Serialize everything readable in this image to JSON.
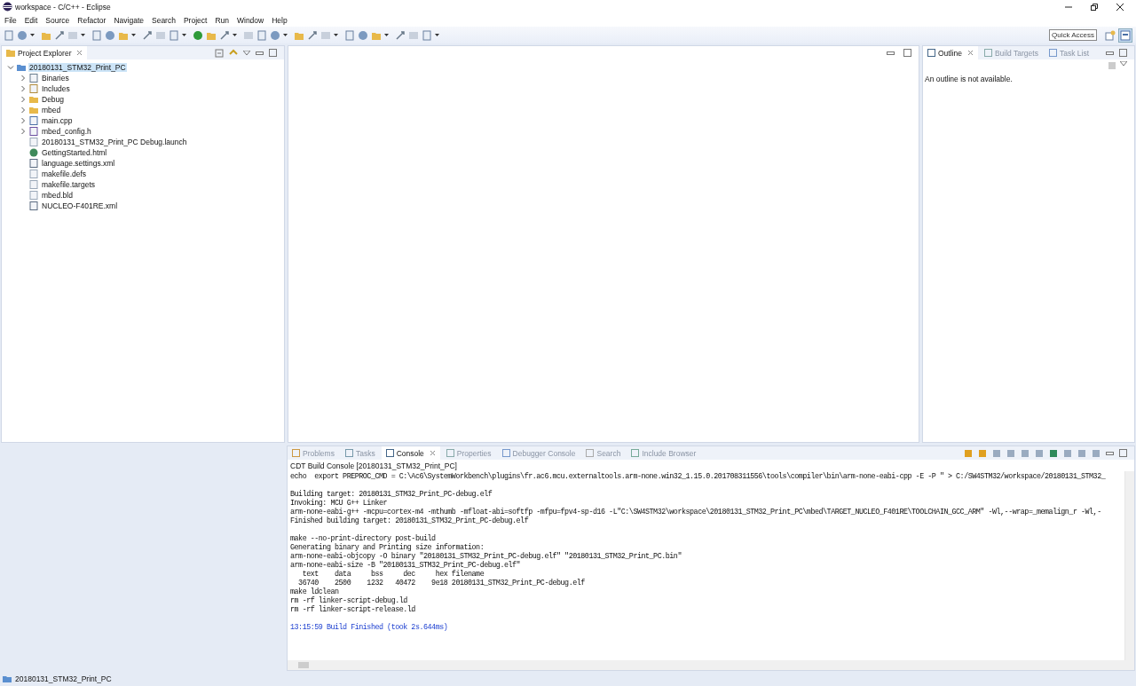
{
  "window": {
    "title": "workspace - C/C++ - Eclipse"
  },
  "menu": [
    "File",
    "Edit",
    "Source",
    "Refactor",
    "Navigate",
    "Search",
    "Project",
    "Run",
    "Window",
    "Help"
  ],
  "quick_access": {
    "placeholder": "Quick Access"
  },
  "project_explorer": {
    "tabs": [
      {
        "label": "Project Explorer",
        "selected": true
      }
    ],
    "tree": [
      {
        "label": "20180131_STM32_Print_PC",
        "kind": "project",
        "expanded": true,
        "selected": true,
        "children": [
          {
            "label": "Binaries",
            "kind": "binaries",
            "expanded": false,
            "selected": false
          },
          {
            "label": "Includes",
            "kind": "includes",
            "expanded": false,
            "selected": false
          },
          {
            "label": "Debug",
            "kind": "folder",
            "expanded": false,
            "selected": false
          },
          {
            "label": "mbed",
            "kind": "folder",
            "expanded": false,
            "selected": false
          },
          {
            "label": "main.cpp",
            "kind": "source",
            "expanded": false,
            "selected": false
          },
          {
            "label": "mbed_config.h",
            "kind": "header",
            "expanded": false,
            "selected": false
          },
          {
            "label": "20180131_STM32_Print_PC Debug.launch",
            "kind": "file",
            "selected": false
          },
          {
            "label": "GettingStarted.html",
            "kind": "globe",
            "selected": false
          },
          {
            "label": "language.settings.xml",
            "kind": "xml",
            "selected": false
          },
          {
            "label": "makefile.defs",
            "kind": "file",
            "selected": false
          },
          {
            "label": "makefile.targets",
            "kind": "file",
            "selected": false
          },
          {
            "label": "mbed.bld",
            "kind": "file",
            "selected": false
          },
          {
            "label": "NUCLEO-F401RE.xml",
            "kind": "xml",
            "selected": false
          }
        ]
      }
    ]
  },
  "outline_panel": {
    "tabs": [
      {
        "label": "Outline",
        "selected": true
      },
      {
        "label": "Build Targets",
        "selected": false
      },
      {
        "label": "Task List",
        "selected": false
      }
    ],
    "message": "An outline is not available."
  },
  "bottom_panel": {
    "tabs": [
      {
        "label": "Problems",
        "selected": false
      },
      {
        "label": "Tasks",
        "selected": false
      },
      {
        "label": "Console",
        "selected": true
      },
      {
        "label": "Properties",
        "selected": false
      },
      {
        "label": "Debugger Console",
        "selected": false
      },
      {
        "label": "Search",
        "selected": false
      },
      {
        "label": "Include Browser",
        "selected": false
      }
    ],
    "console_title": "CDT Build Console [20180131_STM32_Print_PC]",
    "blocks": [
      {
        "kind": "output",
        "lines": [
          "echo  export PREPROC_CMD = C:\\Ac6\\SystemWorkbench\\plugins\\fr.ac6.mcu.externaltools.arm-none.win32_1.15.0.201708311556\\tools\\compiler\\bin\\arm-none-eabi-cpp -E -P \" > C:/SW4STM32/workspace/20180131_STM32_"
        ]
      },
      {
        "kind": "output",
        "lines": [
          "Building target: 20180131_STM32_Print_PC-debug.elf",
          "Invoking: MCU G++ Linker",
          "arm-none-eabi-g++ -mcpu=cortex-m4 -mthumb -mfloat-abi=softfp -mfpu=fpv4-sp-d16 -L\"C:\\SW4STM32\\workspace\\20180131_STM32_Print_PC\\mbed\\TARGET_NUCLEO_F401RE\\TOOLCHAIN_GCC_ARM\" -Wl,--wrap=_memalign_r -Wl,-",
          "Finished building target: 20180131_STM32_Print_PC-debug.elf"
        ]
      },
      {
        "kind": "output",
        "lines": [
          "make --no-print-directory post-build",
          "Generating binary and Printing size information:",
          "arm-none-eabi-objcopy -O binary \"20180131_STM32_Print_PC-debug.elf\" \"20180131_STM32_Print_PC.bin\"",
          "arm-none-eabi-size -B \"20180131_STM32_Print_PC-debug.elf\"",
          "   text    data     bss     dec     hex filename",
          "  36740    2500    1232   40472    9e18 20180131_STM32_Print_PC-debug.elf",
          "make ldclean",
          "rm -rf linker-script-debug.ld",
          "rm -rf linker-script-release.ld"
        ]
      },
      {
        "kind": "status",
        "lines": [
          "13:15:59 Build Finished (took 2s.644ms)"
        ]
      }
    ]
  },
  "status_bar": {
    "text": "20180131_STM32_Print_PC"
  }
}
